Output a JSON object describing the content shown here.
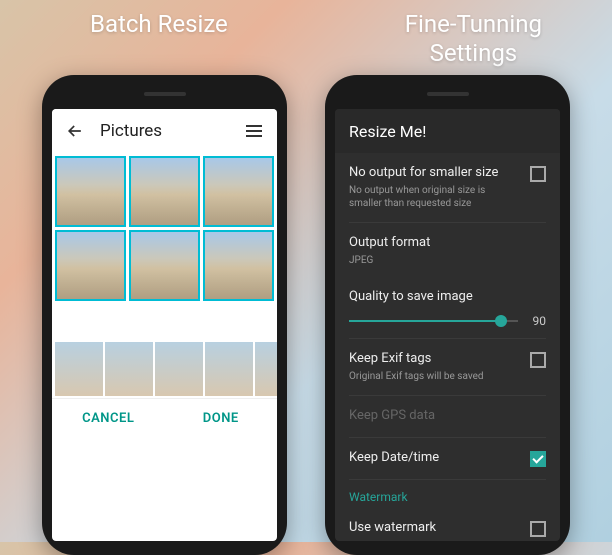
{
  "titles": {
    "left": "Batch Resize",
    "right_l1": "Fine-Tunning",
    "right_l2": "Settings"
  },
  "accent": "#26a69a",
  "left": {
    "toolbar_title": "Pictures",
    "cancel": "CANCEL",
    "done": "DONE"
  },
  "right": {
    "app_title": "Resize Me!",
    "items": [
      {
        "label": "No output for smaller size",
        "sub": "No output when original size is smaller than requested size",
        "checked": false
      },
      {
        "label": "Output format",
        "sub": "JPEG"
      },
      {
        "label": "Quality to save image",
        "slider": true,
        "value": 90
      },
      {
        "label": "Keep Exif tags",
        "sub": "Original Exif tags will be saved",
        "checked": false
      },
      {
        "label": "Keep GPS data",
        "disabled": true
      },
      {
        "label": "Keep Date/time",
        "checked": true
      },
      {
        "section": "Watermark"
      },
      {
        "label": "Use watermark",
        "checked": false
      }
    ]
  }
}
